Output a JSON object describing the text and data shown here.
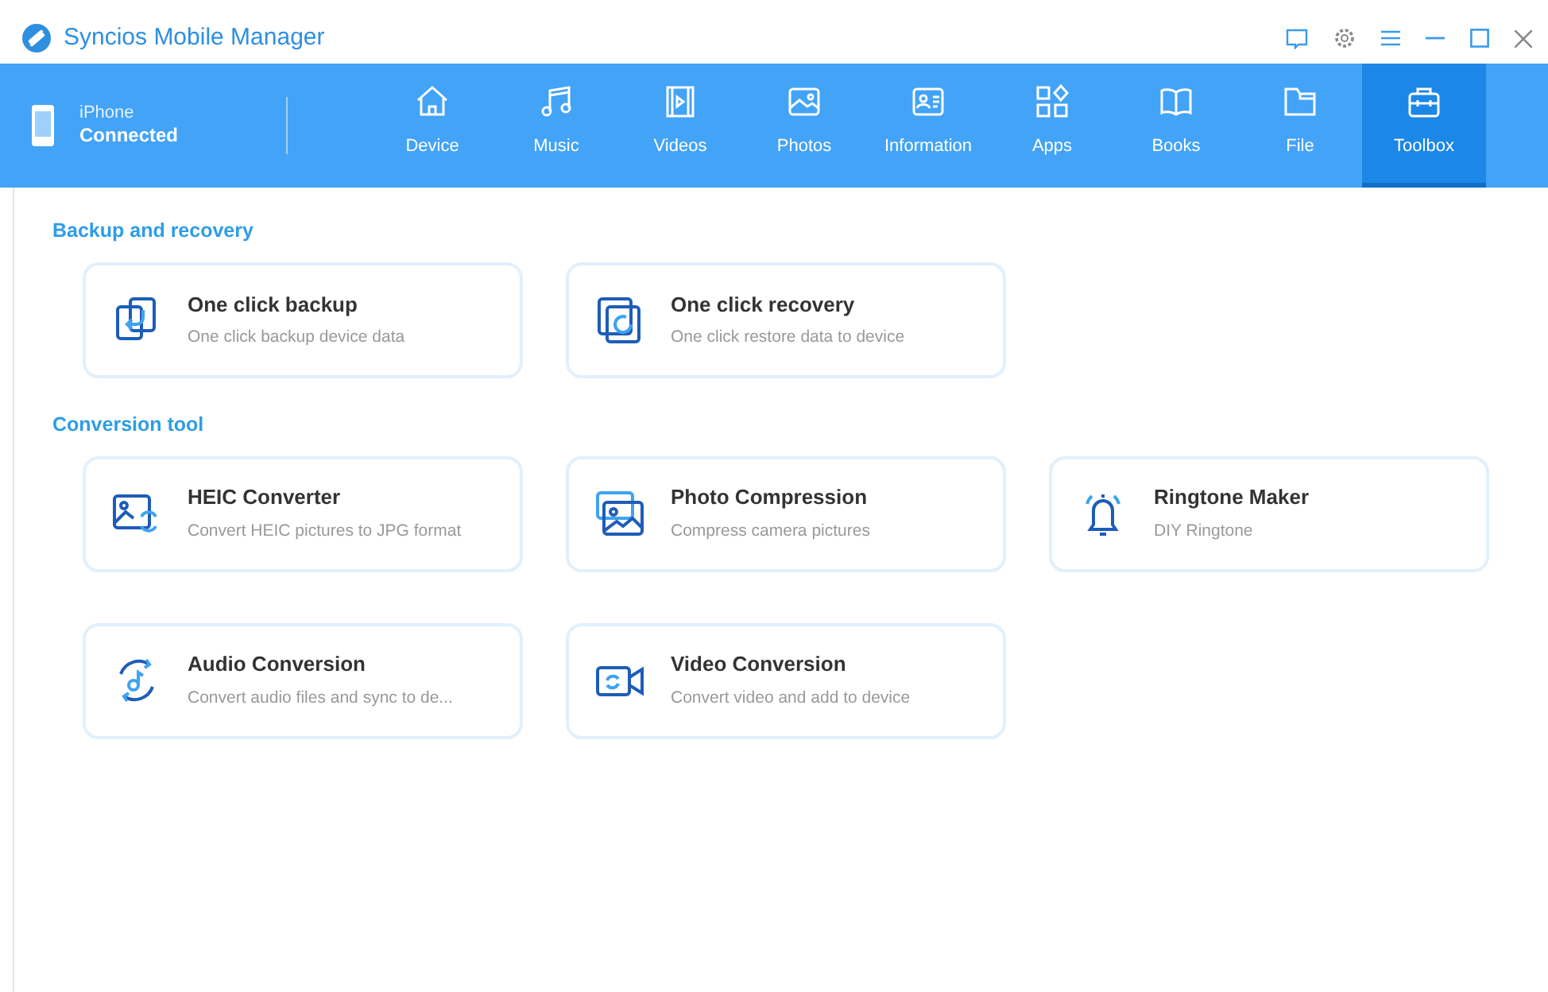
{
  "window": {
    "title": "Syncios Mobile Manager"
  },
  "device": {
    "name": "iPhone",
    "status": "Connected"
  },
  "tabs": [
    {
      "label": "Device",
      "selected": false
    },
    {
      "label": "Music",
      "selected": false
    },
    {
      "label": "Videos",
      "selected": false
    },
    {
      "label": "Photos",
      "selected": false
    },
    {
      "label": "Information",
      "selected": false
    },
    {
      "label": "Apps",
      "selected": false
    },
    {
      "label": "Books",
      "selected": false
    },
    {
      "label": "File",
      "selected": false
    },
    {
      "label": "Toolbox",
      "selected": true
    }
  ],
  "sections": [
    {
      "title": "Backup and recovery",
      "tools": [
        {
          "title": "One click backup",
          "subtitle": "One click backup device data"
        },
        {
          "title": "One click recovery",
          "subtitle": "One click restore data to device"
        }
      ]
    },
    {
      "title": "Conversion tool",
      "tools": [
        {
          "title": "HEIC Converter",
          "subtitle": "Convert HEIC pictures to JPG format"
        },
        {
          "title": "Photo Compression",
          "subtitle": "Compress camera pictures"
        },
        {
          "title": "Ringtone Maker",
          "subtitle": "DIY Ringtone"
        },
        {
          "title": "Audio Conversion",
          "subtitle": "Convert audio files and sync to de..."
        },
        {
          "title": "Video Conversion",
          "subtitle": "Convert video and add to device"
        }
      ]
    }
  ]
}
